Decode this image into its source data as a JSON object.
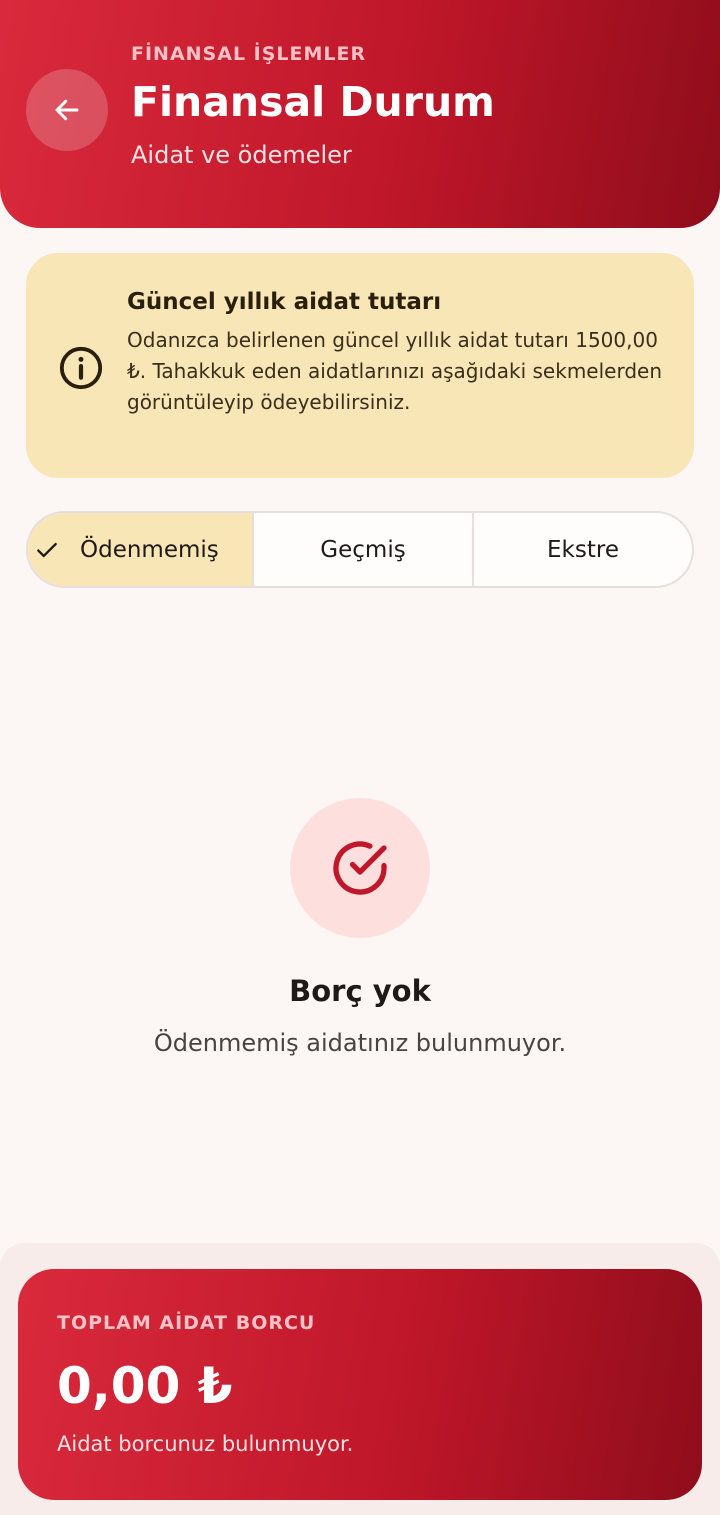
{
  "header": {
    "eyebrow": "FİNANSAL İŞLEMLER",
    "title": "Finansal Durum",
    "subtitle": "Aidat ve ödemeler",
    "back_icon": "arrow-left-icon"
  },
  "info_card": {
    "icon": "info-icon",
    "title": "Güncel yıllık aidat tutarı",
    "text": "Odanızca belirlenen güncel yıllık aidat tutarı 1500,00 ₺. Tahakkuk eden aidatlarınızı aşağıdaki sekmelerden görüntüleyip ödeyebilirsiniz."
  },
  "tabs": [
    {
      "label": "Ödenmemiş",
      "active": true
    },
    {
      "label": "Geçmiş",
      "active": false
    },
    {
      "label": "Ekstre",
      "active": false
    }
  ],
  "empty_state": {
    "icon": "check-circle-icon",
    "title": "Borç yok",
    "text": "Ödenmemiş aidatınız bulunmuyor."
  },
  "total": {
    "label": "TOPLAM AİDAT BORCU",
    "amount": "0,00 ₺",
    "note": "Aidat borcunuz bulunmuyor."
  },
  "colors": {
    "brand_red": "#c0172a",
    "brand_red_dark": "#8f0d1b",
    "info_bg": "#f8e6b6",
    "background": "#fcf7f5"
  }
}
